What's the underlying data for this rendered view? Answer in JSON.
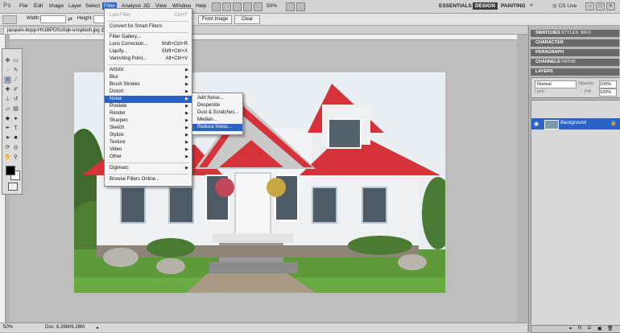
{
  "app": {
    "logo": "Ps",
    "menus": [
      "File",
      "Edit",
      "Image",
      "Layer",
      "Select",
      "Filter",
      "Analysis",
      "3D",
      "View",
      "Window",
      "Help"
    ],
    "active_menu": "Filter",
    "zoom": "50%",
    "workspaces": [
      "ESSENTIALS",
      "DESIGN",
      "PAINTING"
    ],
    "active_workspace": "DESIGN",
    "more": "»",
    "cs_live": "CS Live",
    "window_buttons": [
      "–",
      "□",
      "×"
    ]
  },
  "options": {
    "width_label": "Width:",
    "height_label": "Height:",
    "front_image": "Front Image",
    "clear": "Clear"
  },
  "document": {
    "tab": "jacques-bopp-Hh1BPOSsSqk-unsplash.jpg @ 50% (RGB/8)",
    "status_zoom": "50%",
    "status_doc": "Doc: 6.26M/6.26M"
  },
  "filter_menu": {
    "last_filter": "Last Filter",
    "last_filter_sc": "Ctrl+F",
    "convert": "Convert for Smart Filters",
    "gallery": "Filter Gallery...",
    "lens": "Lens Correction...",
    "lens_sc": "Shift+Ctrl+R",
    "liquify": "Liquify...",
    "liquify_sc": "Shift+Ctrl+X",
    "vanishing": "Vanishing Point...",
    "vanishing_sc": "Alt+Ctrl+V",
    "categories": [
      "Artistic",
      "Blur",
      "Brush Strokes",
      "Distort",
      "Noise",
      "Pixelate",
      "Render",
      "Sharpen",
      "Sketch",
      "Stylize",
      "Texture",
      "Video",
      "Other"
    ],
    "digimarc": "Digimarc",
    "browse": "Browse Filters Online..."
  },
  "noise_menu": {
    "items": [
      "Add Noise...",
      "Despeckle",
      "Dust & Scratches...",
      "Median...",
      "Reduce Noise..."
    ],
    "highlighted": "Reduce Noise..."
  },
  "panels": {
    "swatches": [
      "SWATCHES",
      "STYLES",
      "INFO"
    ],
    "character": "CHARACTER",
    "paragraph": "PARAGRAPH",
    "channels": [
      "CHANNELS",
      "PATHS"
    ],
    "layers": "LAYERS",
    "blend_mode": "Normal",
    "opacity_label": "Opacity:",
    "opacity": "100%",
    "lock_label": "Lock:",
    "fill_label": "Fill:",
    "fill": "100%",
    "layer_name": "Background"
  }
}
